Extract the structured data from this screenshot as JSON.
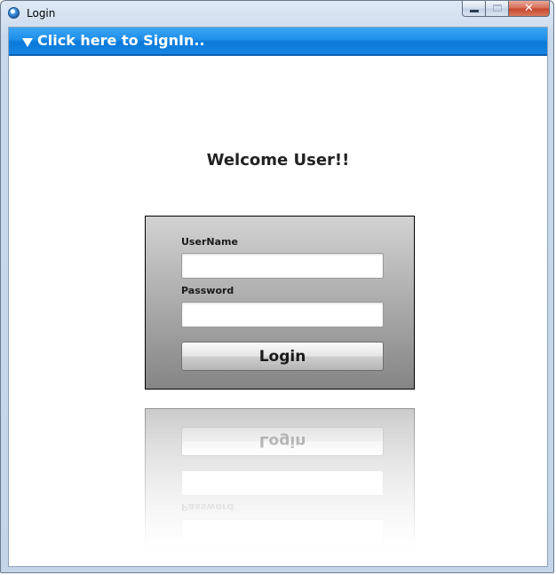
{
  "window": {
    "title": "Login",
    "controls": {
      "minimize_icon": "minimize-icon",
      "maximize_icon": "maximize-icon",
      "close_label": "✕"
    }
  },
  "header": {
    "label": "Click here to SignIn..",
    "icon": "triangle-down-icon",
    "color": "#1a8ae6"
  },
  "main": {
    "welcome": "Welcome User!!"
  },
  "login_form": {
    "username_label": "UserName",
    "username_value": "",
    "password_label": "Password",
    "password_value": "",
    "login_button": "Login"
  }
}
